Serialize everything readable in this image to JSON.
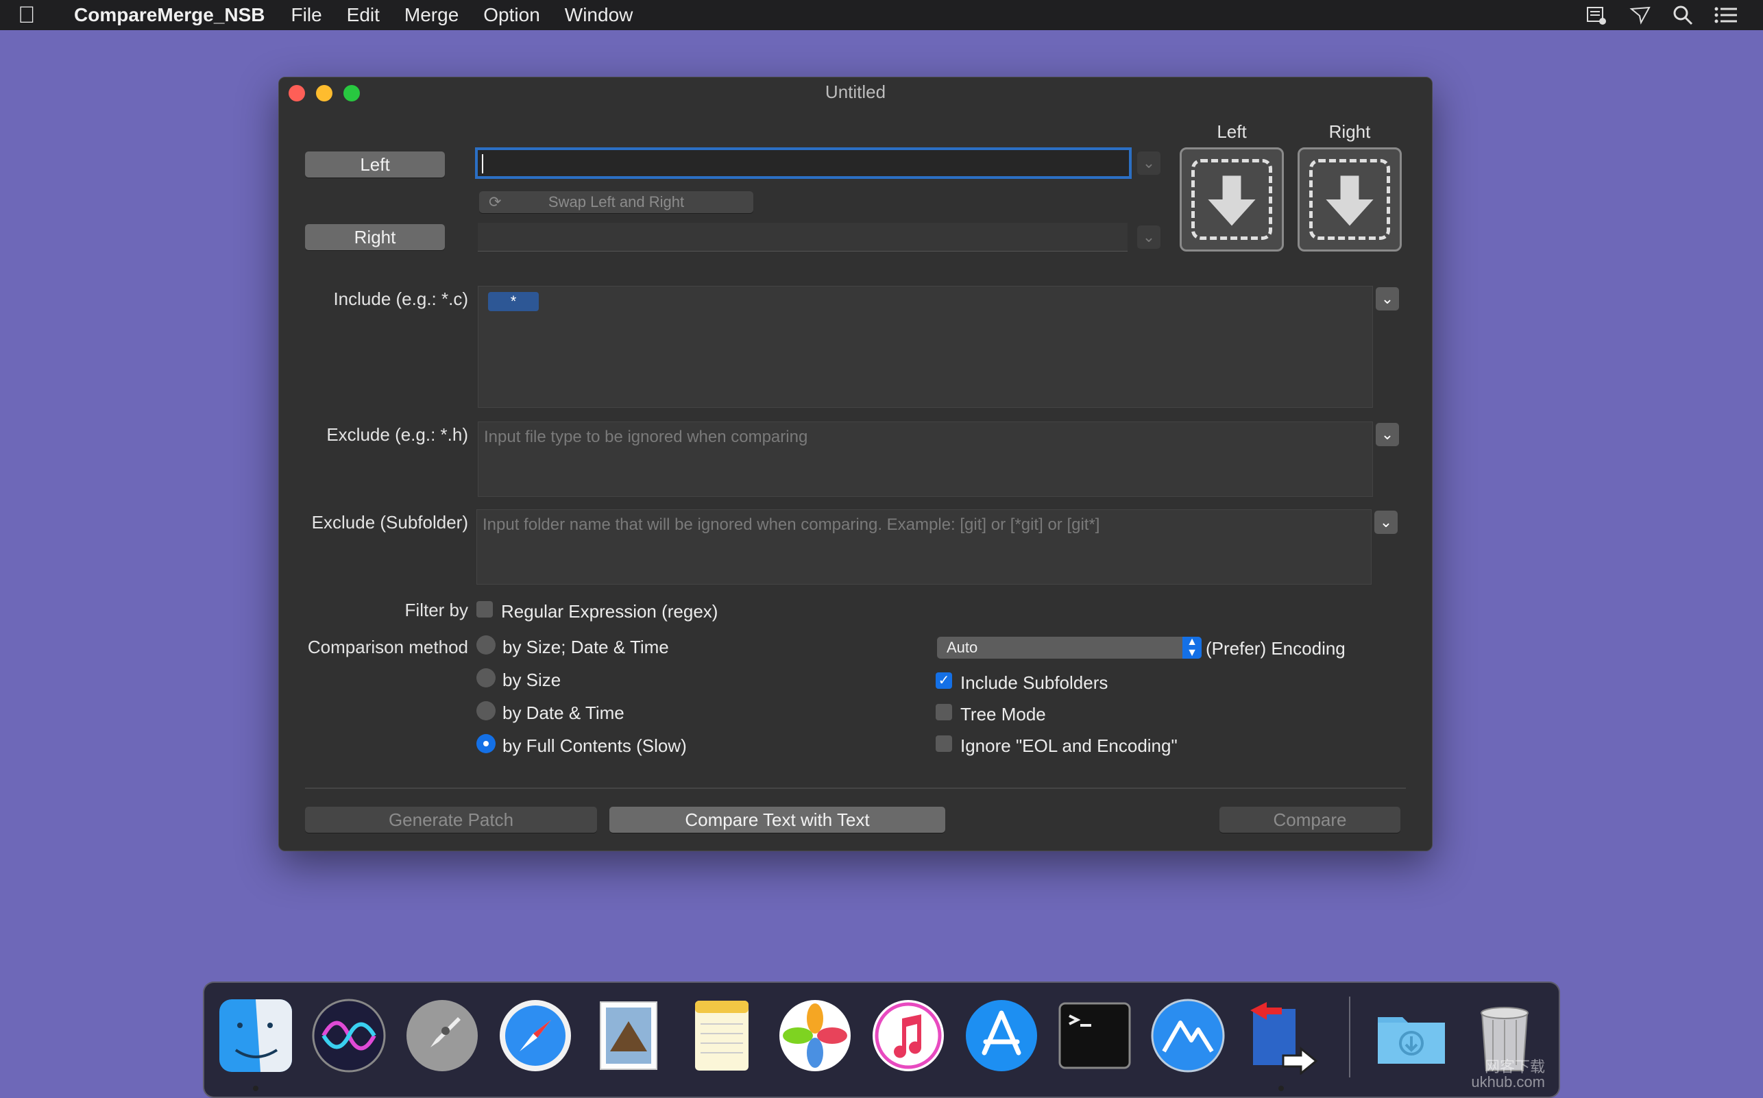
{
  "menubar": {
    "app_name": "CompareMerge_NSB",
    "items": [
      "File",
      "Edit",
      "Merge",
      "Option",
      "Window"
    ]
  },
  "window": {
    "title": "Untitled",
    "left_button": "Left",
    "right_button": "Right",
    "left_path": "",
    "right_path": "",
    "swap_label": "Swap Left and Right",
    "drop_left_label": "Left",
    "drop_right_label": "Right",
    "include_label": "Include (e.g.: *.c)",
    "include_token": "*",
    "exclude_label": "Exclude (e.g.: *.h)",
    "exclude_placeholder": "Input file type to be ignored when comparing",
    "exclude_sub_label": "Exclude (Subfolder)",
    "exclude_sub_placeholder": "Input folder name that will be ignored when comparing. Example: [git] or [*git] or [git*]",
    "filter_label": "Filter by",
    "regex_label": "Regular Expression (regex)",
    "regex_checked": false,
    "method_label": "Comparison method",
    "methods": [
      {
        "label": "by Size; Date & Time",
        "selected": false
      },
      {
        "label": "by Size",
        "selected": false
      },
      {
        "label": "by Date & Time",
        "selected": false
      },
      {
        "label": "by Full Contents (Slow)",
        "selected": true
      }
    ],
    "encoding_value": "Auto",
    "encoding_label": "(Prefer) Encoding",
    "options": [
      {
        "label": "Include Subfolders",
        "checked": true
      },
      {
        "label": "Tree Mode",
        "checked": false
      },
      {
        "label": "Ignore \"EOL and Encoding\"",
        "checked": false
      }
    ],
    "generate_patch": "Generate Patch",
    "compare_text": "Compare Text with Text",
    "compare": "Compare"
  },
  "dock": {
    "apps": [
      "Finder",
      "Siri",
      "Launchpad",
      "Safari",
      "Mail",
      "Notes",
      "Photos",
      "iTunes",
      "App Store",
      "Terminal",
      "Instruments",
      "CompareMerge",
      "Downloads",
      "Trash"
    ]
  },
  "watermark": {
    "line1": "网客下载",
    "line2": "ukhub.com"
  },
  "colors": {
    "desktop": "#6e68b8",
    "window_bg": "#313131",
    "accent": "#1470e6"
  }
}
